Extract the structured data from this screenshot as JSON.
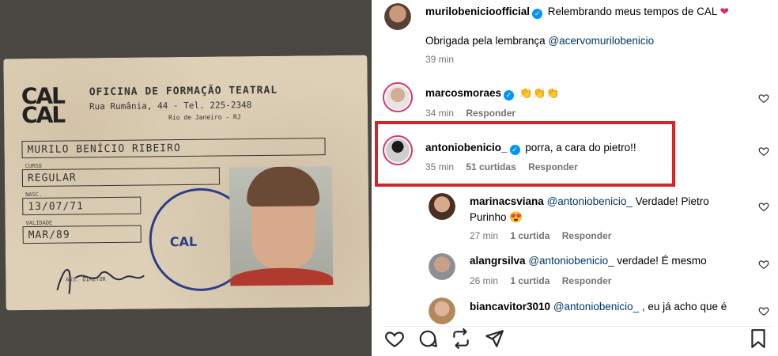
{
  "media": {
    "card_logo": "CAL\nCAL",
    "card_title": "OFICINA DE FORMAÇÃO TEATRAL",
    "card_address": "Rua Rumânia, 44 - Tel. 225-2348",
    "card_city": "Rio de Janeiro - RJ",
    "name_value": "MURILO BENÍCIO RIBEIRO",
    "course_label": "CURSO",
    "course_value": "REGULAR",
    "birth_label": "NASC.",
    "birth_value": "13/07/71",
    "validity_label": "VALIDADE",
    "validity_value": "MAR/89",
    "stamp_text": "CAL",
    "signature_label": "ASS. DIRETOR"
  },
  "caption": {
    "username": "murilobenicioofficial",
    "text": "Relembrando meus tempos de CAL",
    "heart": "❤",
    "line2_prefix": "Obrigada pela lembrança",
    "mention": "@acervomurilobenicio",
    "time": "39 min"
  },
  "comments": [
    {
      "username": "marcosmoraes",
      "text": "👏👏👏",
      "time": "34 min",
      "likes": "",
      "reply": "Responder"
    },
    {
      "username": "antoniobenicio_",
      "text": "porra, a cara do pietro!!",
      "time": "35 min",
      "likes": "51 curtidas",
      "reply": "Responder"
    },
    {
      "username": "marinacsviana",
      "mention": "@antoniobenicio_",
      "text": "Verdade! Pietro",
      "text2": "Purinho 😍",
      "time": "27 min",
      "likes": "1 curtida",
      "reply": "Responder"
    },
    {
      "username": "alangrsilva",
      "mention": "@antoniobenicio_",
      "text": "verdade! É mesmo",
      "time": "26 min",
      "likes": "1 curtida",
      "reply": "Responder"
    },
    {
      "username": "biancavitor3010",
      "mention": "@antoniobenicio_",
      "text": ", eu já acho que é"
    }
  ],
  "colors": {
    "verified": "#0095f6",
    "highlight": "#d3242a",
    "mention": "#00376b",
    "meta": "#737373"
  },
  "icons": [
    "like-icon",
    "comment-icon",
    "share-icon",
    "send-icon",
    "save-icon",
    "verified-icon",
    "heart-icon"
  ]
}
